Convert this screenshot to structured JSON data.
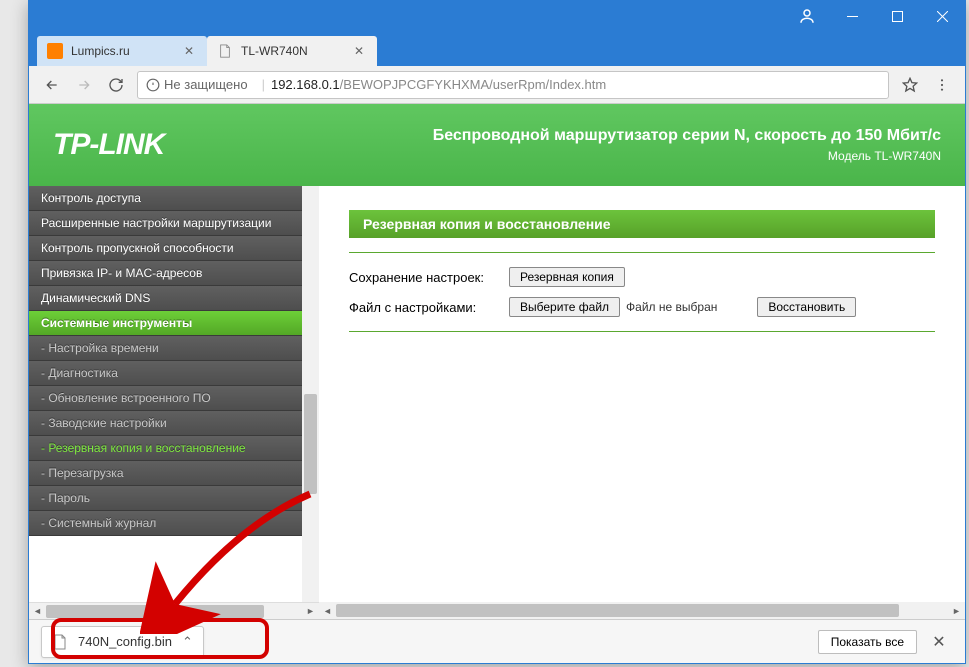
{
  "browser": {
    "tabs": [
      {
        "title": "Lumpics.ru",
        "active": false
      },
      {
        "title": "TL-WR740N",
        "active": true
      }
    ],
    "insecure_label": "Не защищено",
    "url_host": "192.168.0.1",
    "url_path": "/BEWOPJPCGFYKHXMA/userRpm/Index.htm"
  },
  "header": {
    "logo": "TP-LINK",
    "line1": "Беспроводной маршрутизатор серии N, скорость до 150 Мбит/с",
    "line2": "Модель TL-WR740N"
  },
  "sidebar": {
    "items": [
      {
        "label": "Контроль доступа",
        "cls": ""
      },
      {
        "label": "Расширенные настройки маршрутизации",
        "cls": ""
      },
      {
        "label": "Контроль пропускной способности",
        "cls": ""
      },
      {
        "label": "Привязка IP- и MAC-адресов",
        "cls": ""
      },
      {
        "label": "Динамический DNS",
        "cls": ""
      },
      {
        "label": "Системные инструменты",
        "cls": "sel"
      },
      {
        "label": "- Настройка времени",
        "cls": "sub"
      },
      {
        "label": "- Диагностика",
        "cls": "sub"
      },
      {
        "label": "- Обновление встроенного ПО",
        "cls": "sub"
      },
      {
        "label": "- Заводские настройки",
        "cls": "sub"
      },
      {
        "label": "- Резервная копия и восстановление",
        "cls": "sub cur"
      },
      {
        "label": "- Перезагрузка",
        "cls": "sub"
      },
      {
        "label": "- Пароль",
        "cls": "sub"
      },
      {
        "label": "- Системный журнал",
        "cls": "sub"
      }
    ]
  },
  "panel": {
    "title": "Резервная копия и восстановление",
    "save_label": "Сохранение настроек:",
    "backup_btn": "Резервная копия",
    "file_label": "Файл с настройками:",
    "choose_btn": "Выберите файл",
    "no_file": "Файл не выбран",
    "restore_btn": "Восстановить"
  },
  "download": {
    "filename": "740N_config.bin",
    "show_all": "Показать все"
  }
}
